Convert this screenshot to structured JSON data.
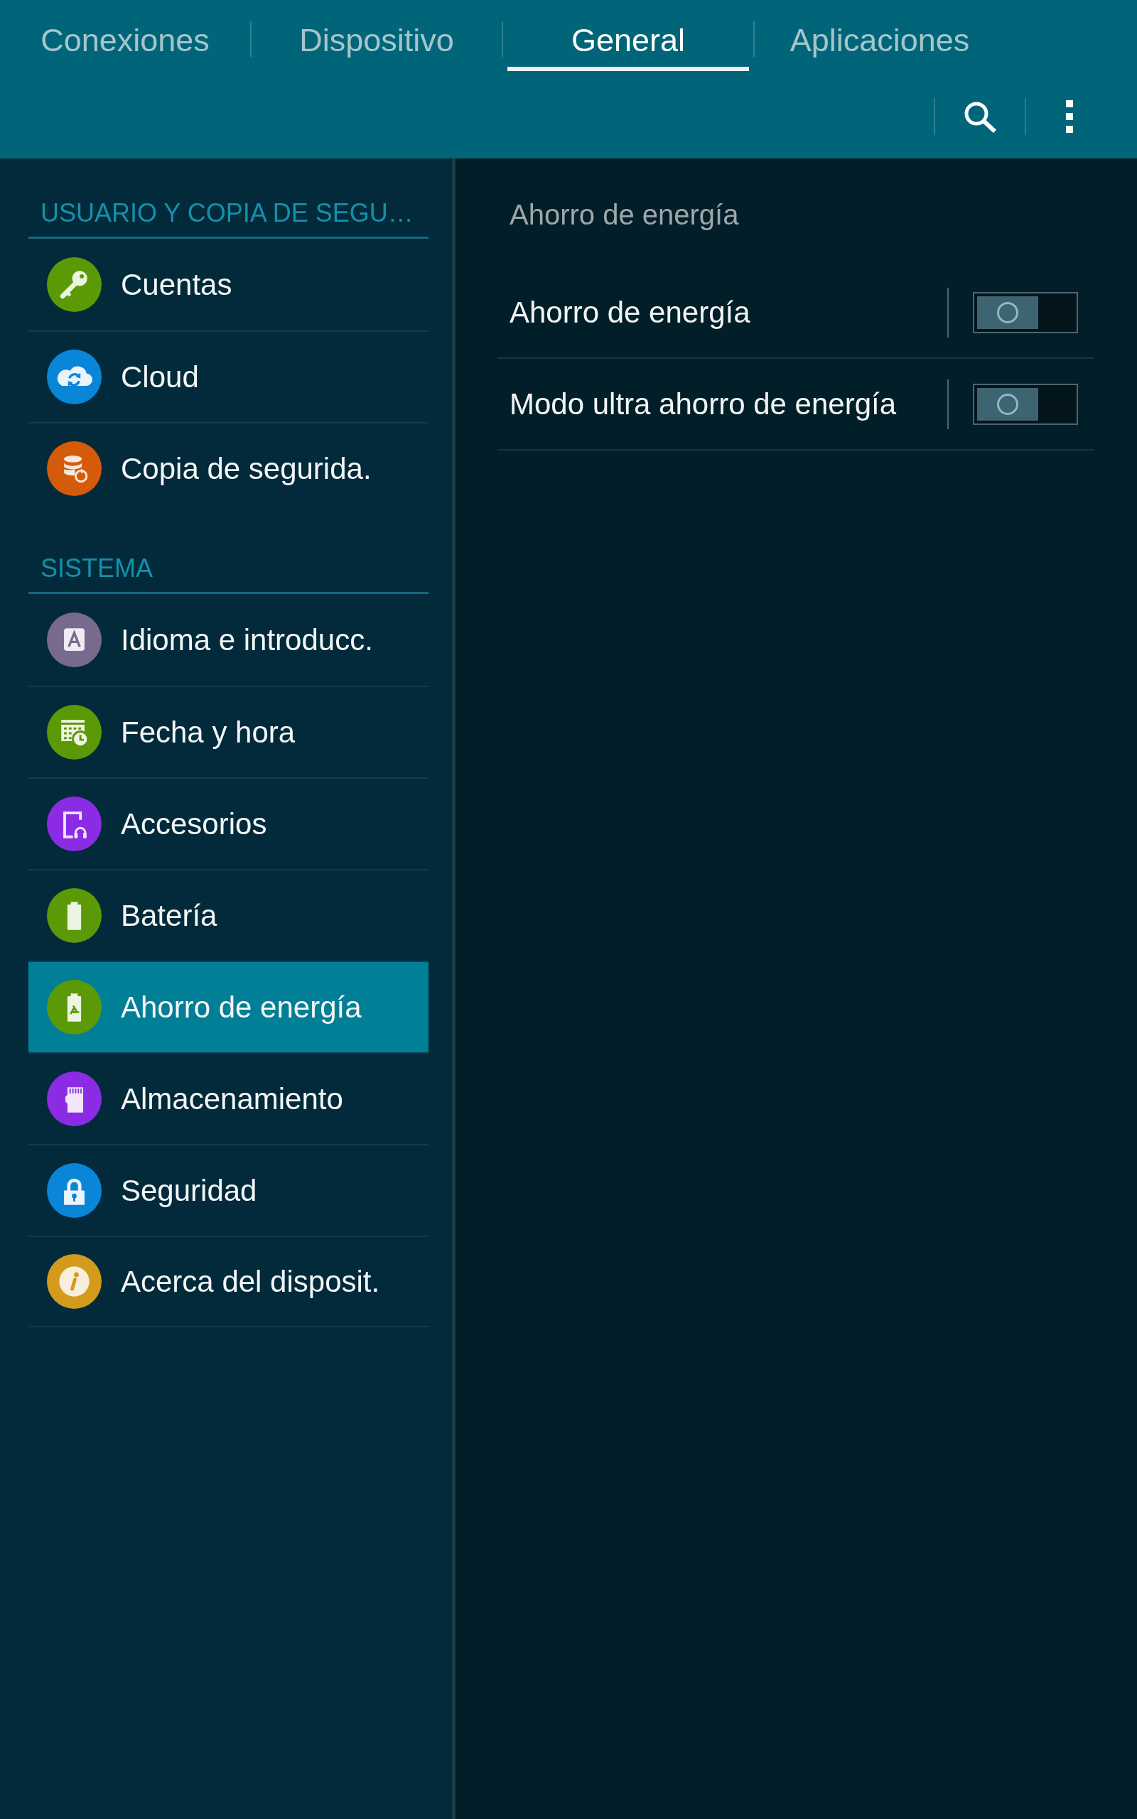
{
  "tabs": [
    {
      "label": "Conexiones",
      "selected": false
    },
    {
      "label": "Dispositivo",
      "selected": false
    },
    {
      "label": "General",
      "selected": true
    },
    {
      "label": "Aplicaciones",
      "selected": false
    }
  ],
  "sidebar": {
    "sections": [
      {
        "title": "USUARIO Y COPIA DE SEGU…",
        "items": [
          {
            "label": "Cuentas",
            "selected": false
          },
          {
            "label": "Cloud",
            "selected": false
          },
          {
            "label": "Copia de segurida.",
            "selected": false
          }
        ]
      },
      {
        "title": "SISTEMA",
        "items": [
          {
            "label": "Idioma e introducc.",
            "selected": false
          },
          {
            "label": "Fecha y hora",
            "selected": false
          },
          {
            "label": "Accesorios",
            "selected": false
          },
          {
            "label": "Batería",
            "selected": false
          },
          {
            "label": "Ahorro de energía",
            "selected": true
          },
          {
            "label": "Almacenamiento",
            "selected": false
          },
          {
            "label": "Seguridad",
            "selected": false
          },
          {
            "label": "Acerca del disposit.",
            "selected": false
          }
        ]
      }
    ]
  },
  "panel": {
    "title": "Ahorro de energía",
    "settings": [
      {
        "label": "Ahorro de energía",
        "on": false
      },
      {
        "label": "Modo ultra ahorro de energía",
        "on": false
      }
    ]
  }
}
